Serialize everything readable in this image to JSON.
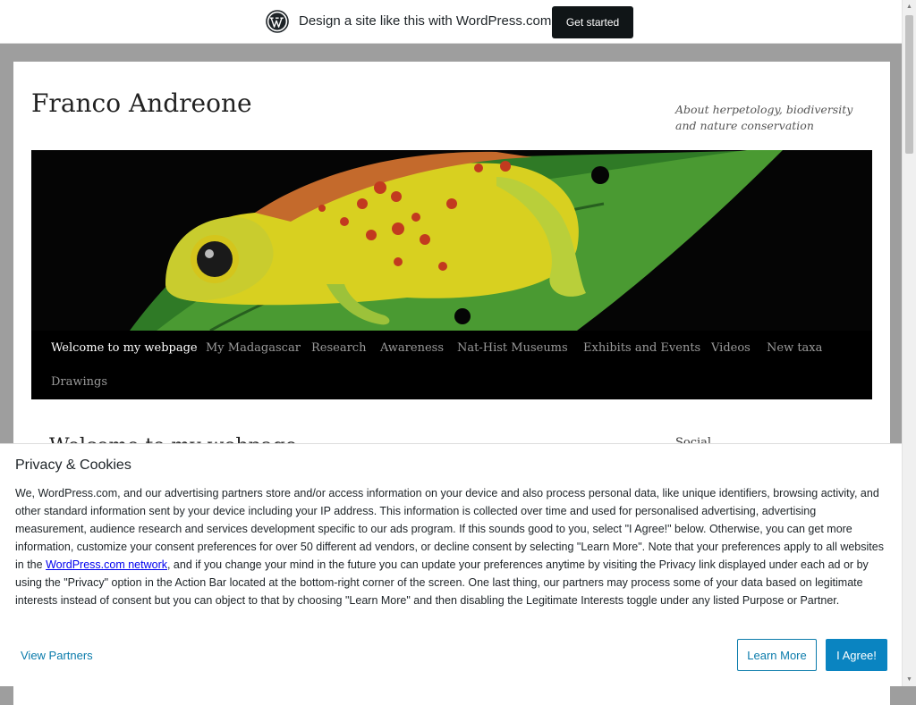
{
  "wp_bar": {
    "logo_icon": "wordpress-logo-icon",
    "promo_text": "Design a site like this with WordPress.com",
    "cta_label": "Get started"
  },
  "site": {
    "title": "Franco Andreone",
    "description": "About herpetology, biodiversity and nature conservation"
  },
  "header_image": {
    "subject": "frog-on-leaf",
    "colors": {
      "background": "#000000",
      "leaf": "#3f8a2a",
      "frog": "#d8d020",
      "spots": "#c23a1f"
    }
  },
  "nav": {
    "items": [
      {
        "label": "Welcome to my webpage",
        "current": true
      },
      {
        "label": "My Madagascar",
        "current": false
      },
      {
        "label": "Research",
        "current": false
      },
      {
        "label": "Awareness",
        "current": false
      },
      {
        "label": "Nat-Hist Museums",
        "current": false
      },
      {
        "label": "Exhibits and Events",
        "current": false
      },
      {
        "label": "Videos",
        "current": false
      },
      {
        "label": "New taxa",
        "current": false
      },
      {
        "label": "Drawings",
        "current": false
      }
    ]
  },
  "content": {
    "post_title": "Welcome to my webpage",
    "widget_title": "Social"
  },
  "privacy": {
    "title": "Privacy & Cookies",
    "text_before_link": "We, WordPress.com, and our advertising partners store and/or access information on your device and also process personal data, like unique identifiers, browsing activity, and other standard information sent by your device including your IP address. This information is collected over time and used for personalised advertising, advertising measurement, audience research and services development specific to our ads program. If this sounds good to you, select \"I Agree!\" below. Otherwise, you can get more information, customize your consent preferences for over 50 different ad vendors, or decline consent by selecting \"Learn More\". Note that your preferences apply to all websites in the ",
    "link_text": "WordPress.com network",
    "text_after_link": ", and if you change your mind in the future you can update your preferences anytime by visiting the Privacy link displayed under each ad or by using the \"Privacy\" option in the Action Bar located at the bottom-right corner of the screen. One last thing, our partners may process some of your data based on legitimate interests instead of consent but you can object to that by choosing \"Learn More\" and then disabling the Legitimate Interests toggle under any listed Purpose or Partner.",
    "view_partners_label": "View Partners",
    "learn_more_label": "Learn More",
    "agree_label": "I Agree!",
    "colors": {
      "accent": "#0a84c1",
      "link": "#0a7bab"
    }
  }
}
